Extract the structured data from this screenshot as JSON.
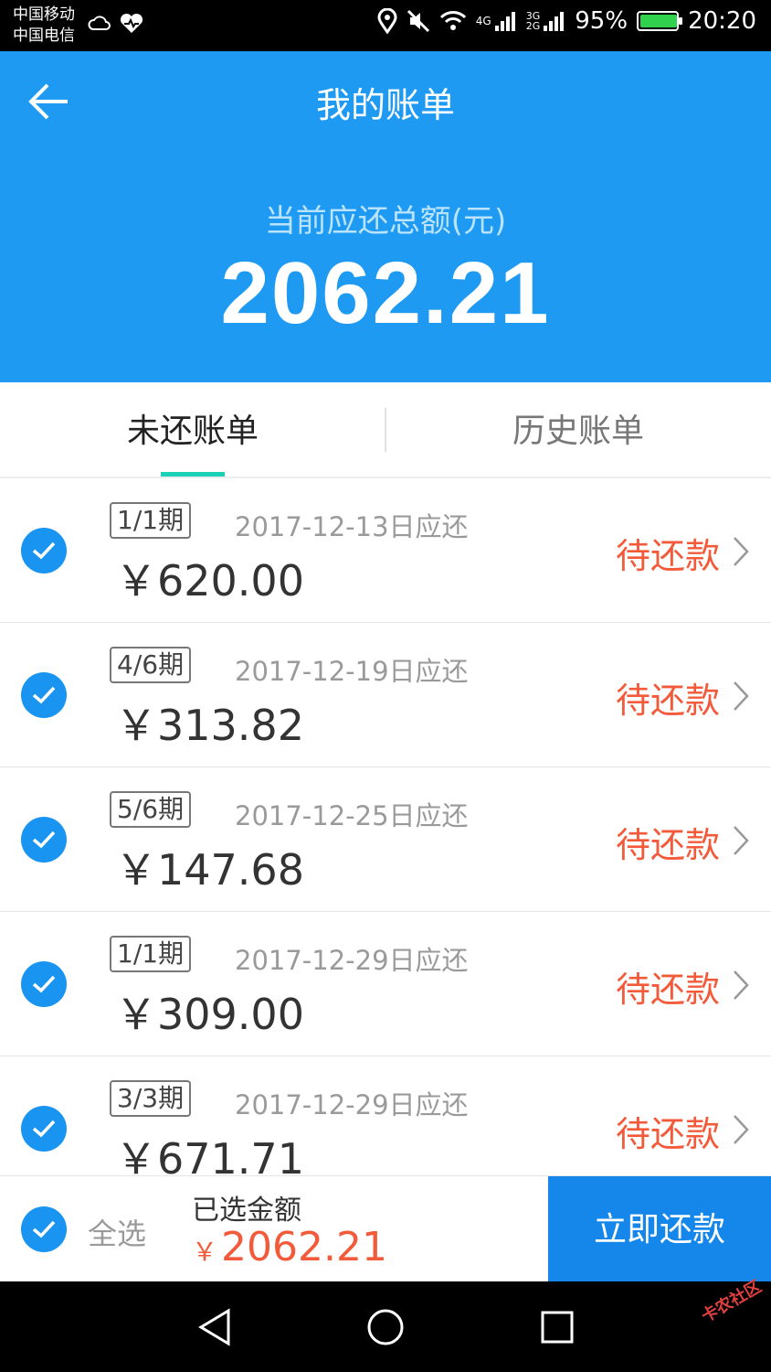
{
  "status_bar": {
    "carrier_1": "中国移动",
    "carrier_2": "中国电信",
    "network_1": "4G",
    "network_2": "3G",
    "network_3": "2G",
    "battery": "95%",
    "time": "20:20"
  },
  "header": {
    "title": "我的账单",
    "total_label": "当前应还总额(元)",
    "total_amount": "2062.21"
  },
  "tabs": {
    "unpaid": "未还账单",
    "history": "历史账单"
  },
  "bills": [
    {
      "period": "1/1期",
      "due": "2017-12-13日应还",
      "amount": "￥620.00",
      "status": "待还款"
    },
    {
      "period": "4/6期",
      "due": "2017-12-19日应还",
      "amount": "￥313.82",
      "status": "待还款"
    },
    {
      "period": "5/6期",
      "due": "2017-12-25日应还",
      "amount": "￥147.68",
      "status": "待还款"
    },
    {
      "period": "1/1期",
      "due": "2017-12-29日应还",
      "amount": "￥309.00",
      "status": "待还款"
    },
    {
      "period": "3/3期",
      "due": "2017-12-29日应还",
      "amount": "￥671.71",
      "status": "待还款"
    }
  ],
  "footer": {
    "select_all": "全选",
    "selected_label": "已选金额",
    "currency": "￥",
    "selected_amount": "2062.21",
    "pay_button": "立即还款"
  },
  "watermark": "卡农社区",
  "colors": {
    "primary_blue": "#1e9af3",
    "pay_button": "#1586ea",
    "status_red": "#f25a3a",
    "tab_indicator": "#1bd0b6"
  }
}
